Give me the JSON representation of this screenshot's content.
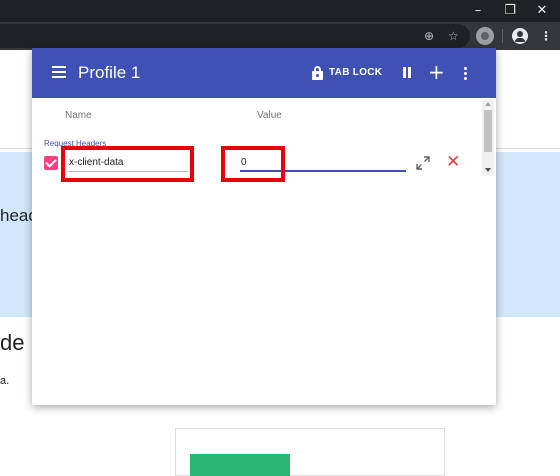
{
  "browser": {
    "window_controls": {
      "minimize": "–",
      "restore": "❐",
      "close": "✕"
    },
    "toolbar_icons": {
      "zoom": "⊕",
      "bookmark": "☆",
      "menu": "⋮"
    }
  },
  "background_page": {
    "band_text": "heac",
    "heading": "de",
    "small_text": "a."
  },
  "popup": {
    "header": {
      "title": "Profile 1",
      "tab_lock_label": "TAB LOCK",
      "plus": "+"
    },
    "columns": {
      "name": "Name",
      "value": "Value"
    },
    "section_label": "Request Headers",
    "headers": [
      {
        "enabled": true,
        "name": "x-client-data",
        "value": "0"
      }
    ],
    "delete": "✕"
  },
  "colors": {
    "header": "#3f51b5",
    "checkbox": "#ff4081",
    "highlight": "#e8000a",
    "delete": "#e53935"
  }
}
